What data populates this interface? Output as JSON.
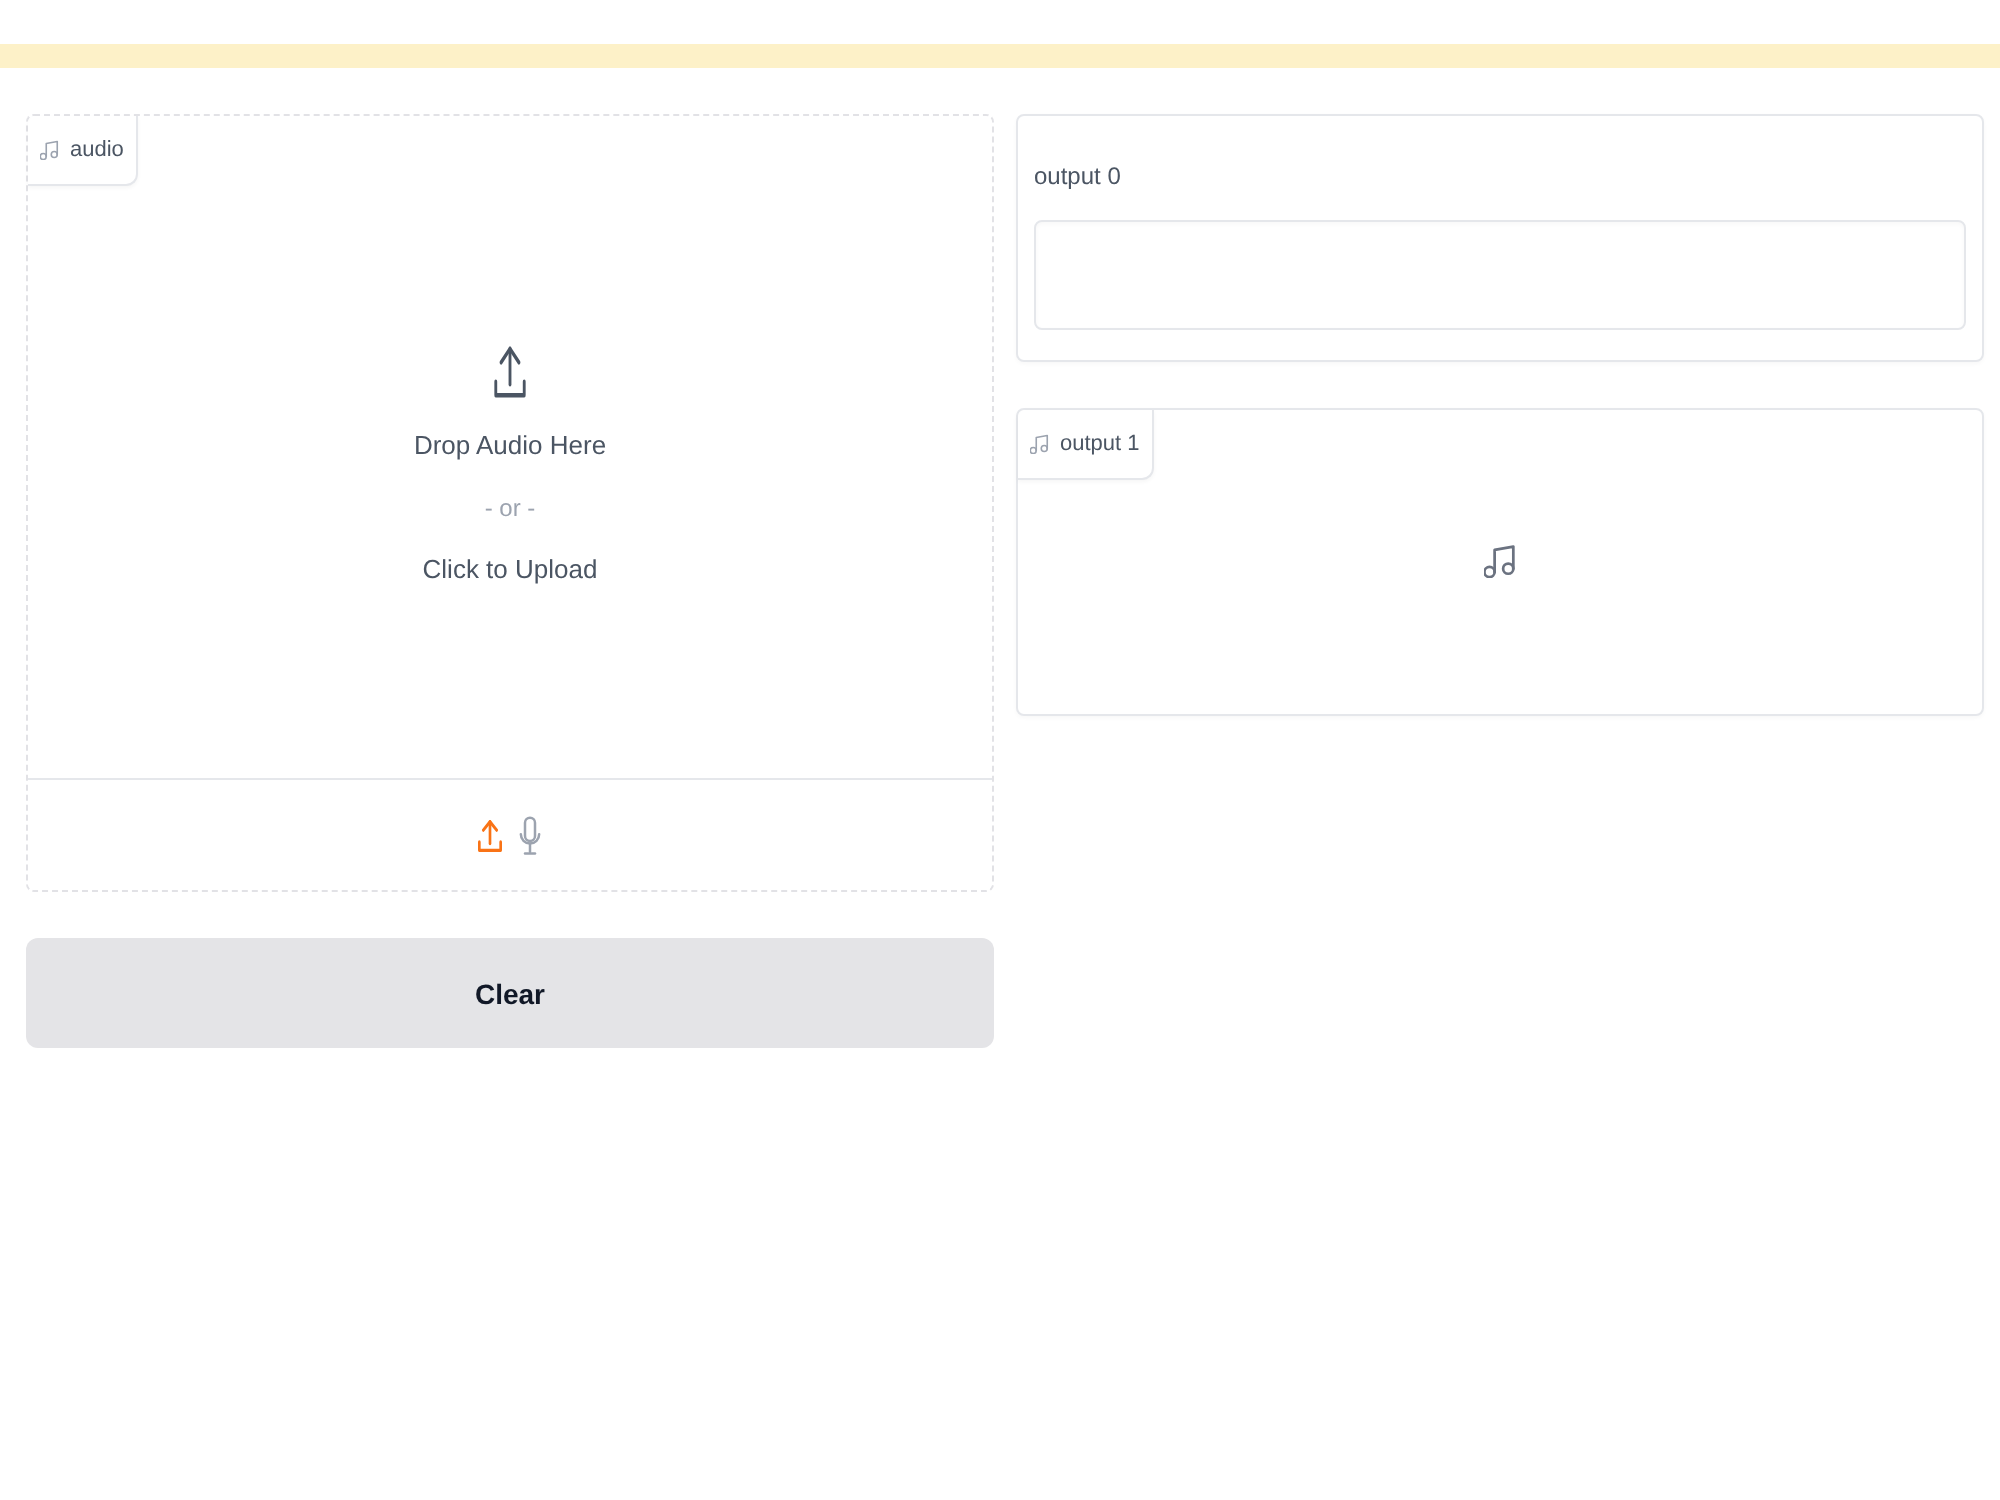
{
  "banner": {
    "shown": true
  },
  "audio_input": {
    "label": "audio",
    "drop_text": "Drop Audio Here",
    "or_text": "- or -",
    "click_text": "Click to Upload",
    "sources": [
      {
        "kind": "upload",
        "selected": true
      },
      {
        "kind": "microphone",
        "selected": false
      }
    ]
  },
  "buttons": [
    {
      "label": "Clear"
    }
  ],
  "outputs": [
    {
      "kind": "textbox",
      "label": "output 0"
    },
    {
      "kind": "audio",
      "label": "output 1"
    }
  ]
}
